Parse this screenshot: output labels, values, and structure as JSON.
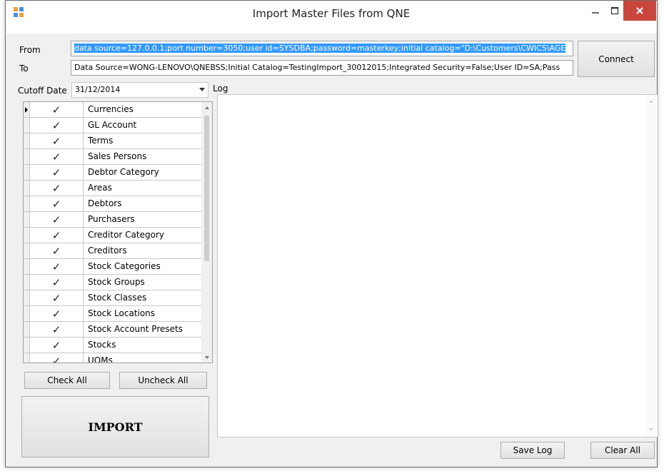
{
  "window": {
    "title": "Import Master Files from QNE",
    "minimize_glyph": "—",
    "maximize_glyph": "☐",
    "close_glyph": "✕"
  },
  "connection": {
    "from_label": "From",
    "to_label": "To",
    "from_value": "data source=127.0.0.1;port number=3050;user id=SYSDBA;password=masterkey;initial catalog=\"D:\\Customers\\CWICS\\AGE",
    "to_value": "Data Source=WONG-LENOVO\\QNEBSS;Initial Catalog=TestingImport_30012015;Integrated Security=False;User ID=SA;Pass",
    "connect_button": "Connect"
  },
  "cutoff": {
    "label": "Cutoff Date",
    "value": "31/12/2014"
  },
  "log": {
    "label": "Log",
    "save_button": "Save Log",
    "clear_button": "Clear All"
  },
  "files": [
    {
      "name": "Currencies",
      "checked": true
    },
    {
      "name": "GL Account",
      "checked": true
    },
    {
      "name": "Terms",
      "checked": true
    },
    {
      "name": "Sales Persons",
      "checked": true
    },
    {
      "name": "Debtor Category",
      "checked": true
    },
    {
      "name": "Areas",
      "checked": true
    },
    {
      "name": "Debtors",
      "checked": true
    },
    {
      "name": "Purchasers",
      "checked": true
    },
    {
      "name": "Creditor Category",
      "checked": true
    },
    {
      "name": "Creditors",
      "checked": true
    },
    {
      "name": "Stock Categories",
      "checked": true
    },
    {
      "name": "Stock Groups",
      "checked": true
    },
    {
      "name": "Stock Classes",
      "checked": true
    },
    {
      "name": "Stock Locations",
      "checked": true
    },
    {
      "name": "Stock Account Presets",
      "checked": true
    },
    {
      "name": "Stocks",
      "checked": true
    },
    {
      "name": "UOMs",
      "checked": true
    }
  ],
  "actions": {
    "check_all": "Check All",
    "uncheck_all": "Uncheck All",
    "import": "IMPORT"
  },
  "icons": {
    "check": "✓"
  }
}
